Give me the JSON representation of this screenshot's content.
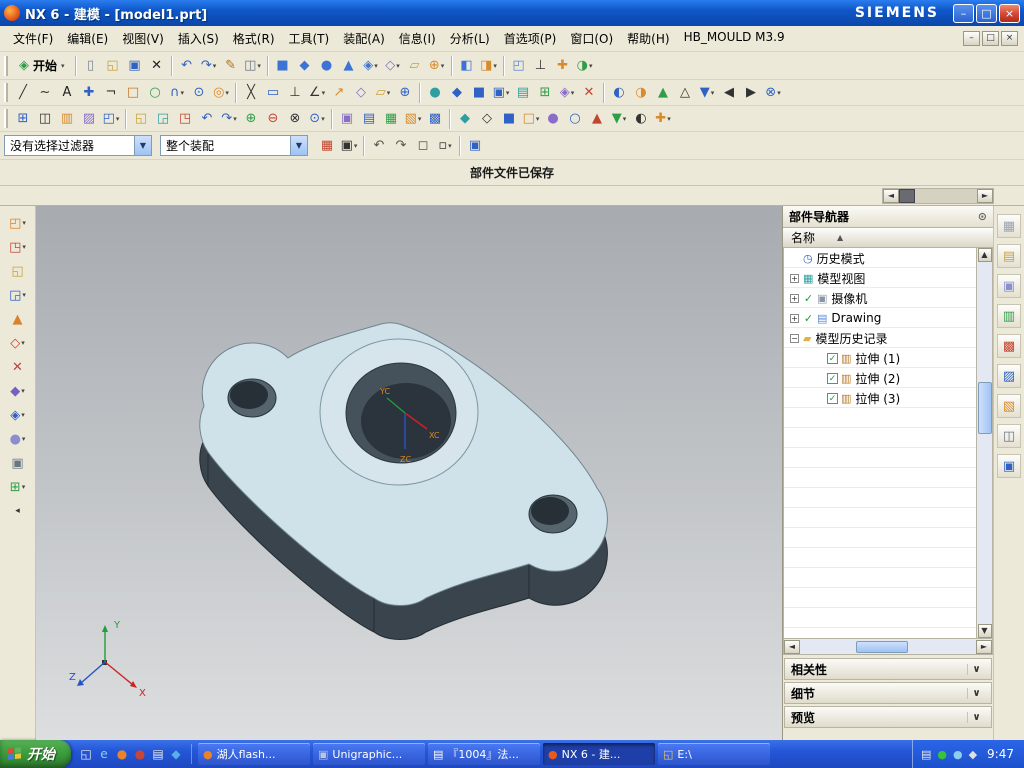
{
  "colors": {
    "model_top": "#cfe2ea",
    "model_side": "#3a444d",
    "model_boss": "#d6e5ec",
    "hole_wall": "#55646d",
    "hole_dark": "#272f37",
    "bore_wall": "#46525b",
    "bore_floor": "#2b343c",
    "axis_x": "#cc2222",
    "axis_y": "#1f9e3c",
    "axis_z": "#2a52c8",
    "wcs_label": "#d98a2b"
  },
  "glyphs": {
    "up": "▲",
    "down": "▼",
    "left": "◄",
    "right": "►",
    "caret": "▾",
    "chevron": "∨",
    "sort": "▲"
  },
  "titlebar": {
    "title": "NX 6 - 建模 - [model1.prt]",
    "brand": "SIEMENS",
    "buttons": {
      "minimize": "–",
      "maximize": "□",
      "close": "×"
    }
  },
  "menubar": {
    "items": [
      "文件(F)",
      "编辑(E)",
      "视图(V)",
      "插入(S)",
      "格式(R)",
      "工具(T)",
      "装配(A)",
      "信息(I)",
      "分析(L)",
      "首选项(P)",
      "窗口(O)",
      "帮助(H)",
      "HB_MOULD M3.9"
    ],
    "mdi_buttons": [
      "–",
      "□",
      "×"
    ]
  },
  "toolbar_main": {
    "start_label": "开始",
    "icons": [
      {
        "g": "▯",
        "c": "#7a8794"
      },
      {
        "g": "◱",
        "c": "#c9a23d"
      },
      {
        "g": "▣",
        "c": "#2f62c4"
      },
      {
        "g": "✕",
        "c": "#222222"
      },
      {
        "sep": 1
      },
      {
        "g": "↶",
        "c": "#2f62c4"
      },
      {
        "g": "↷",
        "c": "#2f62c4",
        "d": 1
      },
      {
        "g": "✎",
        "c": "#b2701f"
      },
      {
        "g": "◫",
        "c": "#6b7685",
        "d": 1
      },
      {
        "sep": 1
      },
      {
        "g": "■",
        "c": "#3b74d6"
      },
      {
        "g": "◆",
        "c": "#3b74d6"
      },
      {
        "g": "●",
        "c": "#3b74d6"
      },
      {
        "g": "▲",
        "c": "#3b74d6"
      },
      {
        "g": "◈",
        "c": "#3b74d6",
        "d": 1
      },
      {
        "g": "◇",
        "c": "#8a6cc9",
        "d": 1
      },
      {
        "g": "▱",
        "c": "#c9a23d"
      },
      {
        "g": "⊕",
        "c": "#d98a2b",
        "d": 1
      },
      {
        "sep": 1
      },
      {
        "g": "◧",
        "c": "#3b74d6"
      },
      {
        "g": "◨",
        "c": "#d98a2b",
        "d": 1
      },
      {
        "sep": 1
      },
      {
        "g": "◰",
        "c": "#5a8ad6"
      },
      {
        "g": "⊥",
        "c": "#333333"
      },
      {
        "g": "✚",
        "c": "#d98a2b"
      },
      {
        "g": "◑",
        "c": "#2f9e49",
        "d": 1
      }
    ]
  },
  "toolbar_row2": {
    "icons": [
      {
        "g": "╱",
        "c": "#333333"
      },
      {
        "g": "~",
        "c": "#333333"
      },
      {
        "g": "A",
        "c": "#222222"
      },
      {
        "g": "✚",
        "c": "#2f62c4"
      },
      {
        "g": "¬",
        "c": "#333333"
      },
      {
        "g": "□",
        "c": "#c9762a"
      },
      {
        "g": "○",
        "c": "#2f9e49"
      },
      {
        "g": "∩",
        "c": "#2f62c4",
        "d": 1
      },
      {
        "g": "⊙",
        "c": "#2f62c4"
      },
      {
        "g": "◎",
        "c": "#d98a2b",
        "d": 1
      },
      {
        "sep": 1
      },
      {
        "g": "╳",
        "c": "#333333"
      },
      {
        "g": "▭",
        "c": "#2f62c4"
      },
      {
        "g": "⊥",
        "c": "#333333"
      },
      {
        "g": "∠",
        "c": "#333333",
        "d": 1
      },
      {
        "g": "↗",
        "c": "#d98a2b"
      },
      {
        "g": "◇",
        "c": "#8a6cc9"
      },
      {
        "g": "▱",
        "c": "#c9a23d",
        "d": 1
      },
      {
        "g": "⊕",
        "c": "#2f62c4"
      },
      {
        "sep": 1
      },
      {
        "g": "●",
        "c": "#2e9ea0"
      },
      {
        "g": "◆",
        "c": "#2f62c4"
      },
      {
        "g": "■",
        "c": "#2f62c4"
      },
      {
        "g": "▣",
        "c": "#2f62c4",
        "d": 1
      },
      {
        "g": "▤",
        "c": "#2e9ea0"
      },
      {
        "g": "⊞",
        "c": "#2f9e49"
      },
      {
        "g": "◈",
        "c": "#8a6cc9",
        "d": 1
      },
      {
        "g": "✕",
        "c": "#c4452f"
      },
      {
        "sep": 1
      },
      {
        "g": "◐",
        "c": "#2f62c4"
      },
      {
        "g": "◑",
        "c": "#d98a2b"
      },
      {
        "g": "▲",
        "c": "#2f9e49"
      },
      {
        "g": "△",
        "c": "#333333"
      },
      {
        "g": "▼",
        "c": "#2f62c4",
        "d": 1
      },
      {
        "g": "◀",
        "c": "#333333"
      },
      {
        "g": "▶",
        "c": "#333333"
      },
      {
        "g": "⊗",
        "c": "#2f62c4",
        "d": 1
      }
    ]
  },
  "toolbar_row3": {
    "icons": [
      {
        "g": "⊞",
        "c": "#2f62c4"
      },
      {
        "g": "◫",
        "c": "#333333"
      },
      {
        "g": "▥",
        "c": "#d98a2b"
      },
      {
        "g": "▨",
        "c": "#8a6cc9"
      },
      {
        "g": "◰",
        "c": "#2f62c4",
        "d": 1
      },
      {
        "sep": 1
      },
      {
        "g": "◱",
        "c": "#c9a23d"
      },
      {
        "g": "◲",
        "c": "#2e9ea0"
      },
      {
        "g": "◳",
        "c": "#c4452f"
      },
      {
        "g": "↶",
        "c": "#2f62c4"
      },
      {
        "g": "↷",
        "c": "#2f62c4",
        "d": 1
      },
      {
        "g": "⊕",
        "c": "#2f9e49"
      },
      {
        "g": "⊖",
        "c": "#c4452f"
      },
      {
        "g": "⊗",
        "c": "#333333"
      },
      {
        "g": "⊙",
        "c": "#2f62c4",
        "d": 1
      },
      {
        "sep": 1
      },
      {
        "g": "▣",
        "c": "#8a6cc9"
      },
      {
        "g": "▤",
        "c": "#2f62c4"
      },
      {
        "g": "▦",
        "c": "#2f9e49"
      },
      {
        "g": "▧",
        "c": "#d98a2b",
        "d": 1
      },
      {
        "g": "▩",
        "c": "#2f62c4"
      },
      {
        "sep": 1
      },
      {
        "g": "◆",
        "c": "#2e9ea0"
      },
      {
        "g": "◇",
        "c": "#333333"
      },
      {
        "g": "■",
        "c": "#2f62c4"
      },
      {
        "g": "□",
        "c": "#d98a2b",
        "d": 1
      },
      {
        "g": "●",
        "c": "#8a6cc9"
      },
      {
        "g": "○",
        "c": "#2f62c4"
      },
      {
        "g": "▲",
        "c": "#c4452f"
      },
      {
        "g": "▼",
        "c": "#2f9e49",
        "d": 1
      },
      {
        "g": "◐",
        "c": "#333333"
      },
      {
        "g": "✚",
        "c": "#d98a2b",
        "d": 1
      }
    ]
  },
  "filter_bar": {
    "filter_value": "没有选择过滤器",
    "scope_value": "整个装配",
    "icons": [
      {
        "g": "▦",
        "c": "#c4452f"
      },
      {
        "g": "▣",
        "c": "#333333",
        "d": 1
      },
      {
        "sep": 1
      },
      {
        "g": "↶",
        "c": "#555555"
      },
      {
        "g": "↷",
        "c": "#555555"
      },
      {
        "g": "◻",
        "c": "#555555"
      },
      {
        "g": "▫",
        "c": "#333333",
        "d": 1
      },
      {
        "sep": 1
      },
      {
        "g": "▣",
        "c": "#2f62c4"
      }
    ]
  },
  "status_bar": {
    "message": "部件文件已保存"
  },
  "left_toolbar": {
    "collapse": "◂",
    "icons": [
      {
        "g": "◰",
        "c": "#d9822b",
        "d": 1
      },
      {
        "g": "◳",
        "c": "#c4452f",
        "d": 1
      },
      {
        "g": "◱",
        "c": "#c9a23d"
      },
      {
        "g": "◲",
        "c": "#2f62c4",
        "d": 1
      },
      {
        "g": "▲",
        "c": "#d9822b"
      },
      {
        "g": "◇",
        "c": "#c4452f",
        "d": 1
      },
      {
        "g": "✕",
        "c": "#c43f3f"
      },
      {
        "g": "◆",
        "c": "#7a5fc0",
        "d": 1
      },
      {
        "g": "◈",
        "c": "#2f62c4",
        "d": 1
      },
      {
        "g": "●",
        "c": "#8a8fd0",
        "d": 1
      },
      {
        "g": "▣",
        "c": "#6b7685"
      },
      {
        "g": "⊞",
        "c": "#2f9e49",
        "d": 1
      }
    ]
  },
  "right_toolbar": {
    "icons": [
      {
        "g": "▦",
        "c": "#9aa2b2"
      },
      {
        "g": "▤",
        "c": "#caa23d"
      },
      {
        "g": "▣",
        "c": "#8a8fd0"
      },
      {
        "g": "▥",
        "c": "#2f9e49"
      },
      {
        "g": "▩",
        "c": "#c4452f"
      },
      {
        "g": "▨",
        "c": "#2f62c4"
      },
      {
        "g": "▧",
        "c": "#d98a2b"
      },
      {
        "g": "◫",
        "c": "#6b7685"
      },
      {
        "g": "▣",
        "c": "#2f62c4"
      }
    ]
  },
  "viewport": {
    "triad": {
      "x": "X",
      "y": "Y",
      "z": "Z"
    },
    "wcs": {
      "x": "XC",
      "y": "YC",
      "z": "ZC"
    }
  },
  "navigator": {
    "title": "部件导航器",
    "column": "名称",
    "rows": [
      {
        "ind": 0,
        "exp": "",
        "chk": "",
        "g": "◷",
        "c": "#2f62c4",
        "label": "历史模式"
      },
      {
        "ind": 0,
        "exp": "+",
        "chk": "",
        "g": "▦",
        "c": "#2e9ea0",
        "label": "模型视图"
      },
      {
        "ind": 0,
        "exp": "+",
        "chk": "check",
        "g": "▣",
        "c": "#8a94a8",
        "label": "摄像机"
      },
      {
        "ind": 0,
        "exp": "+",
        "chk": "check",
        "g": "▤",
        "c": "#5a8ad6",
        "label": "Drawing"
      },
      {
        "ind": 0,
        "exp": "-",
        "chk": "",
        "g": "▰",
        "c": "#e0b33c",
        "label": "模型历史记录"
      },
      {
        "ind": 2,
        "exp": "",
        "chk": "box",
        "g": "▥",
        "c": "#b8762a",
        "label": "拉伸 (1)"
      },
      {
        "ind": 2,
        "exp": "",
        "chk": "box",
        "g": "▥",
        "c": "#b8762a",
        "label": "拉伸 (2)"
      },
      {
        "ind": 2,
        "exp": "",
        "chk": "box",
        "g": "▥",
        "c": "#b8762a",
        "label": "拉伸 (3)"
      }
    ],
    "panels": [
      {
        "label": "相关性"
      },
      {
        "label": "细节"
      },
      {
        "label": "预览"
      }
    ]
  },
  "taskbar": {
    "start_label": "开始",
    "quick_launch": [
      {
        "g": "◱",
        "c": "#e8e8e8"
      },
      {
        "g": "e",
        "c": "#8ecdf2"
      },
      {
        "g": "●",
        "c": "#e8832a"
      },
      {
        "g": "●",
        "c": "#cc4433"
      },
      {
        "g": "▤",
        "c": "#e8e8e8"
      },
      {
        "g": "◆",
        "c": "#58b0e8"
      }
    ],
    "tasks": [
      {
        "icon": "●",
        "ic": "#e8832a",
        "label": "湖人flash...",
        "active": false
      },
      {
        "icon": "▣",
        "ic": "#c0c6d0",
        "label": "Unigraphic...",
        "active": false
      },
      {
        "icon": "▤",
        "ic": "#ffffff",
        "label": "『1004』法...",
        "active": false
      },
      {
        "icon": "●",
        "ic": "#e85a1a",
        "label": "NX 6 - 建...",
        "active": true
      },
      {
        "icon": "◱",
        "ic": "#e8c85a",
        "label": "E:\\",
        "active": false
      }
    ],
    "tray_icons": [
      {
        "g": "▤",
        "c": "#e8e8e8"
      },
      {
        "g": "●",
        "c": "#39c339"
      },
      {
        "g": "●",
        "c": "#8ecdf2"
      },
      {
        "g": "◆",
        "c": "#e0e0e0"
      }
    ],
    "time": "9:47"
  }
}
